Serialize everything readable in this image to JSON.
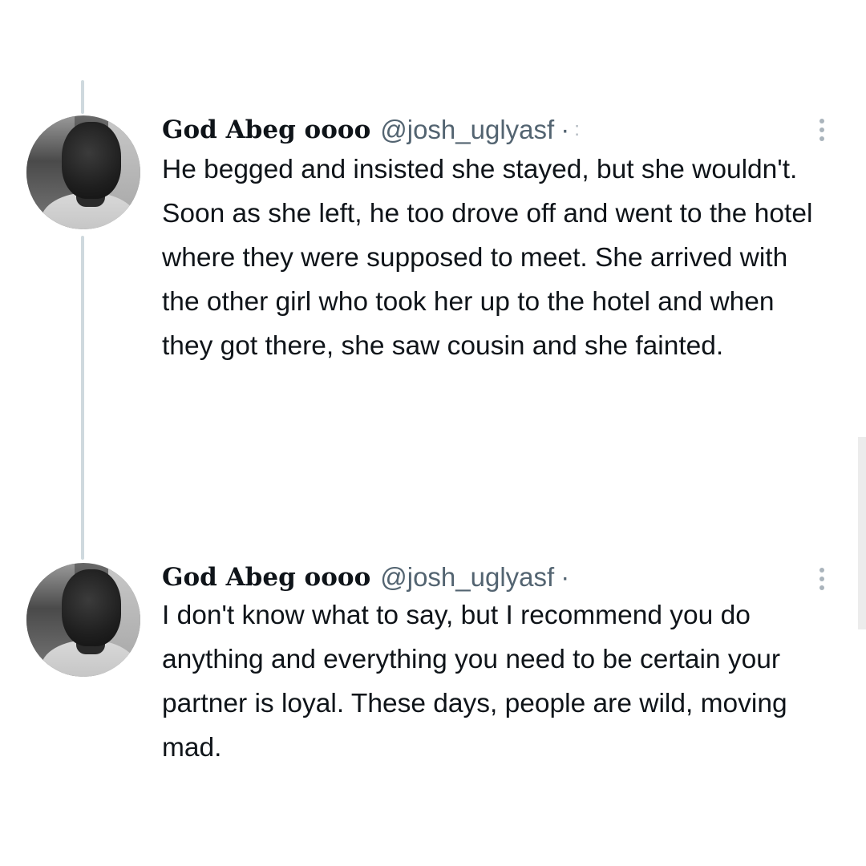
{
  "thread": {
    "tweets": [
      {
        "author_name": "God Abeg oooo",
        "handle": "@josh_uglyasf",
        "separator": "·",
        "time": ":",
        "avatar_icon": "profile-photo",
        "more_icon": "more-vertical-icon",
        "text": "He begged and insisted she stayed, but she wouldn't. Soon as she left, he too drove off and went to the hotel where they were supposed to meet. She arrived with the other girl who took her up to the hotel and when they got there, she saw cousin and she fainted."
      },
      {
        "author_name": "God Abeg oooo",
        "handle": "@josh_uglyasf",
        "separator": "·",
        "avatar_icon": "profile-photo",
        "more_icon": "more-vertical-icon",
        "text": "I don't know what to say, but I recommend you do anything and everything you need to be certain your partner is loyal. These days, people are wild, moving mad."
      }
    ]
  },
  "colors": {
    "background": "#ffffff",
    "text_primary": "#0f1419",
    "text_secondary": "#536471",
    "thread_line": "#cfd9de"
  }
}
